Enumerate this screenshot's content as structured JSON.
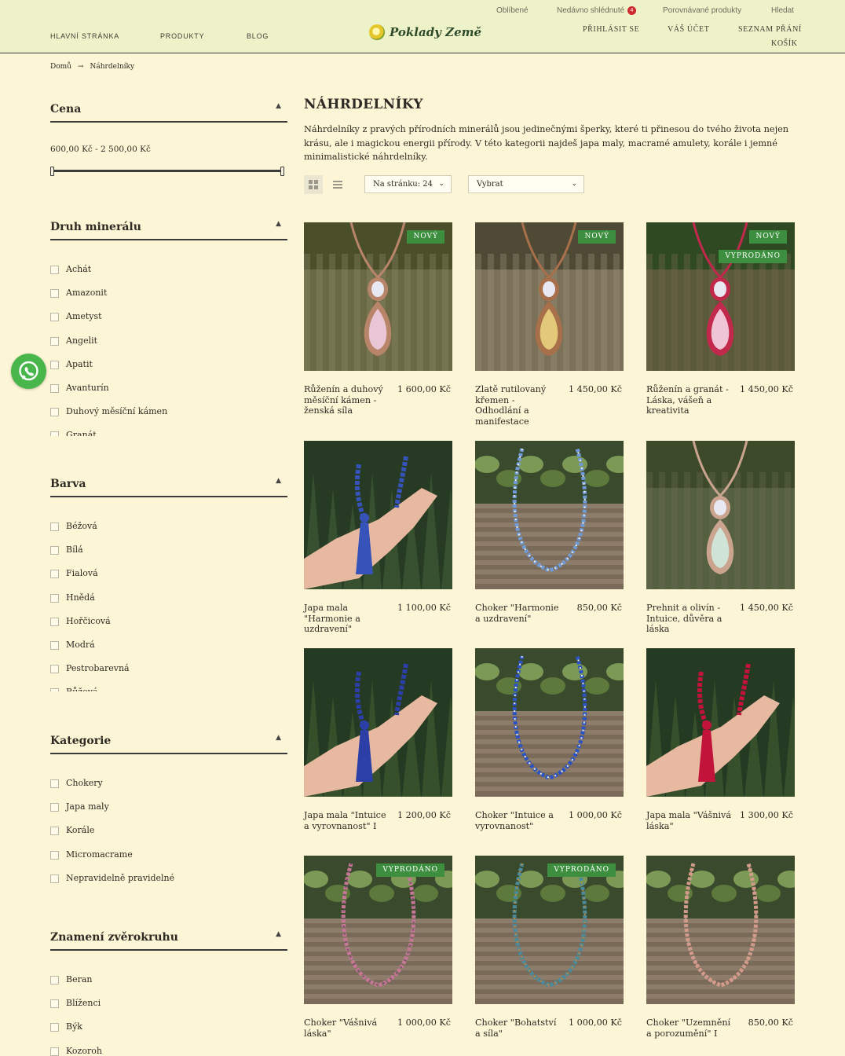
{
  "header": {
    "utility_links": [
      "Oblíbené",
      "Nedávno shlédnuté",
      "Porovnávané produkty",
      "Hledat"
    ],
    "recent_count": "4",
    "nav": [
      "HLAVNÍ STRÁNKA",
      "PRODUKTY",
      "BLOG"
    ],
    "brand": "Poklady Země",
    "account_links": [
      "PŘIHLÁSIT SE",
      "VÁŠ ÚČET",
      "SEZNAM PŘÁNÍ",
      "KOŠÍK"
    ]
  },
  "breadcrumb": {
    "home": "Domů",
    "separator": "→",
    "current": "Náhrdelníky"
  },
  "sidebar": {
    "price": {
      "title": "Cena",
      "range_text": "600,00 Kč - 2 500,00 Kč",
      "min_value": "600,00 Kč",
      "max_value": "2 500,00 Kč"
    },
    "mineral": {
      "title": "Druh minerálu",
      "options": [
        "Achát",
        "Amazonit",
        "Ametyst",
        "Angelit",
        "Apatit",
        "Avanturín",
        "Duhový měsíční kámen",
        "Granát"
      ]
    },
    "color": {
      "title": "Barva",
      "options": [
        "Béžová",
        "Bílá",
        "Fialová",
        "Hnědá",
        "Hořčicová",
        "Modrá",
        "Pestrobarevná",
        "Růžová"
      ]
    },
    "category": {
      "title": "Kategorie",
      "options": [
        "Chokery",
        "Japa maly",
        "Korále",
        "Micromacrame",
        "Nepravidelně pravidelné"
      ]
    },
    "zodiac": {
      "title": "Znamení zvěrokruhu",
      "options": [
        "Beran",
        "Blíženci",
        "Býk",
        "Kozoroh"
      ]
    }
  },
  "main": {
    "title": "NÁHRDELNÍKY",
    "description": "Náhrdelníky z pravých přírodních minerálů jsou jedinečnými šperky, které ti přinesou do tvého života nejen krásu, ale i magickou energii přírody. V této kategorii najdeš japa maly, macramé amulety, korále i jemné minimalistické náhrdelníky.",
    "per_page": "Na stránku: 24",
    "sort": "Vybrat"
  },
  "products": [
    {
      "name": "Růženín a duhový měsíční kámen - ženská síla",
      "price": "1 600,00 Kč",
      "badges": [
        "NOVÝ"
      ],
      "image": "pendant-rose"
    },
    {
      "name": "Zlatě rutilovaný křemen - Odhodlání a manifestace",
      "price": "1 450,00 Kč",
      "badges": [
        "NOVÝ"
      ],
      "image": "pendant-gold"
    },
    {
      "name": "Růženín a granát - Láska, vášeň a kreativita",
      "price": "1 450,00 Kč",
      "badges": [
        "NOVÝ",
        "VYPRODÁNO"
      ],
      "image": "pendant-red"
    },
    {
      "name": "Japa mala \"Harmonie a uzdravení\"",
      "price": "1 100,00 Kč",
      "badges": [],
      "image": "mala-blue"
    },
    {
      "name": "Choker \"Harmonie a uzdravení\"",
      "price": "850,00 Kč",
      "badges": [],
      "image": "choker-blue-white"
    },
    {
      "name": "Prehnit a olivín - Intuice, důvěra a láska",
      "price": "1 450,00 Kč",
      "badges": [],
      "image": "pendant-green"
    },
    {
      "name": "Japa mala \"Intuice a vyrovnanost\" I",
      "price": "1 200,00 Kč",
      "badges": [],
      "image": "mala-blue-dark"
    },
    {
      "name": "Choker \"Intuice a vyrovnanost\"",
      "price": "1 000,00 Kč",
      "badges": [],
      "image": "choker-blue"
    },
    {
      "name": "Japa mala \"Vášnivá láska\"",
      "price": "1 300,00 Kč",
      "badges": [],
      "image": "mala-red"
    },
    {
      "name": "Choker \"Vášnivá láska\"",
      "price": "1 000,00 Kč",
      "badges": [
        "VYPRODÁNO"
      ],
      "image": "choker-pink"
    },
    {
      "name": "Choker \"Bohatství a síla\"",
      "price": "1 000,00 Kč",
      "badges": [
        "VYPRODÁNO"
      ],
      "image": "choker-multi"
    },
    {
      "name": "Choker \"Uzemnění a porozumění\" I",
      "price": "850,00 Kč",
      "badges": [],
      "image": "choker-jasper"
    }
  ]
}
